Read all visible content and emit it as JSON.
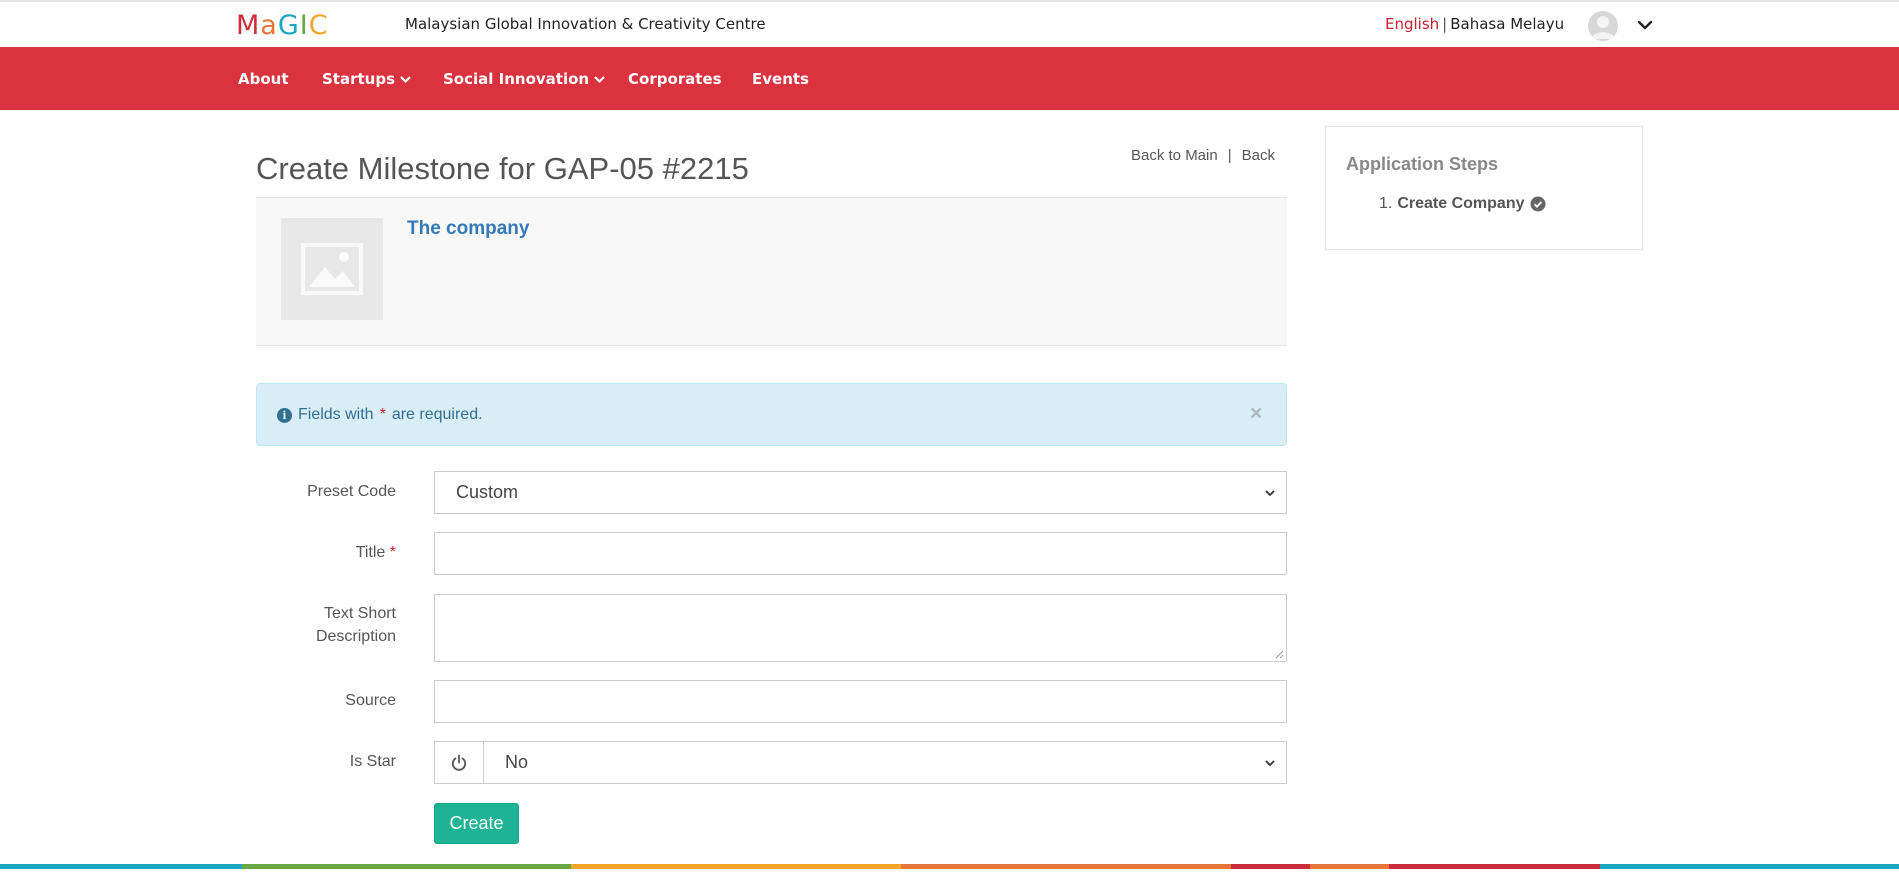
{
  "header": {
    "logo": "MaGIC",
    "tagline": "Malaysian Global Innovation & Creativity Centre",
    "lang_english": "English",
    "lang_separator": "|",
    "lang_malay": "Bahasa Melayu",
    "avatar_icon": "user-avatar-icon",
    "user_menu_icon": "chevron-down-icon"
  },
  "nav": {
    "items": [
      {
        "label": "About"
      },
      {
        "label": "Startups"
      },
      {
        "label": "Social Innovation"
      },
      {
        "label": "Corporates"
      },
      {
        "label": "Events"
      }
    ]
  },
  "page": {
    "title": "Create Milestone for GAP-05 #2215",
    "back_to_main": "Back to Main",
    "pipe": "|",
    "back": "Back"
  },
  "company": {
    "name": "The company",
    "thumb_icon": "image-placeholder-icon"
  },
  "alert": {
    "prefix": "Fields with",
    "asterisk": "*",
    "suffix": "are required.",
    "close": "×"
  },
  "form": {
    "preset_code_label": "Preset Code",
    "preset_code_value": "Custom",
    "title_label": "Title",
    "required_mark": "*",
    "title_value": "",
    "short_desc_label_1": "Text Short",
    "short_desc_label_2": "Description",
    "short_desc_value": "",
    "source_label": "Source",
    "source_value": "",
    "is_star_label": "Is Star",
    "is_star_value": "No",
    "create_label": "Create"
  },
  "steps": {
    "title": "Application Steps",
    "item_number": "1.",
    "item_label": "Create Company"
  },
  "colors": {
    "brand_red": "#da323f",
    "link_blue": "#337ab7",
    "button_green": "#1eb394",
    "alert_bg": "#d9edf7",
    "stripe": [
      "#1ba6c1",
      "#6aa641",
      "#f3a42a",
      "#e6763a",
      "#cb2d3a",
      "#e6763a",
      "#cb2d3a",
      "#1ba6c1"
    ]
  }
}
